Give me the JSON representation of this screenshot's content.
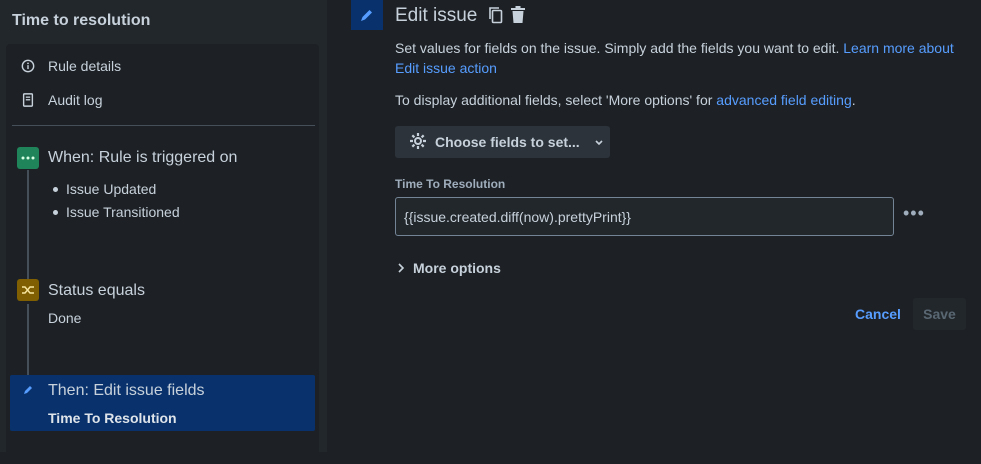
{
  "sidebar": {
    "title": "Time to resolution",
    "nav": [
      {
        "label": "Rule details",
        "icon": "info-icon"
      },
      {
        "label": "Audit log",
        "icon": "document-icon"
      }
    ],
    "trigger": {
      "title": "When: Rule is triggered on",
      "icon": "more-horizontal-icon",
      "color": "#1f845a",
      "items": [
        "Issue Updated",
        "Issue Transitioned"
      ]
    },
    "condition": {
      "title": "Status equals",
      "subtitle": "Done",
      "icon": "shuffle-icon",
      "color": "#7f5f01"
    },
    "action": {
      "title": "Then: Edit issue fields",
      "subtitle": "Time To Resolution",
      "icon": "pencil-icon",
      "color": "#09326c"
    }
  },
  "main": {
    "title": "Edit issue",
    "description": "Set values for fields on the issue. Simply add the fields you want to edit.",
    "learn_more": "Learn more about Edit issue action",
    "additional_prefix": "To display additional fields, select 'More options' for",
    "additional_link": "advanced field editing",
    "additional_suffix": ".",
    "choose_fields": "Choose fields to set...",
    "field": {
      "label": "Time To Resolution",
      "value": "{{issue.created.diff(now).prettyPrint}}"
    },
    "more_options": "More options",
    "cancel": "Cancel",
    "save": "Save"
  },
  "colors": {
    "background": "#1d2125",
    "sidebar": "#22272b",
    "accent": "#579dff",
    "selected": "#09326c"
  }
}
